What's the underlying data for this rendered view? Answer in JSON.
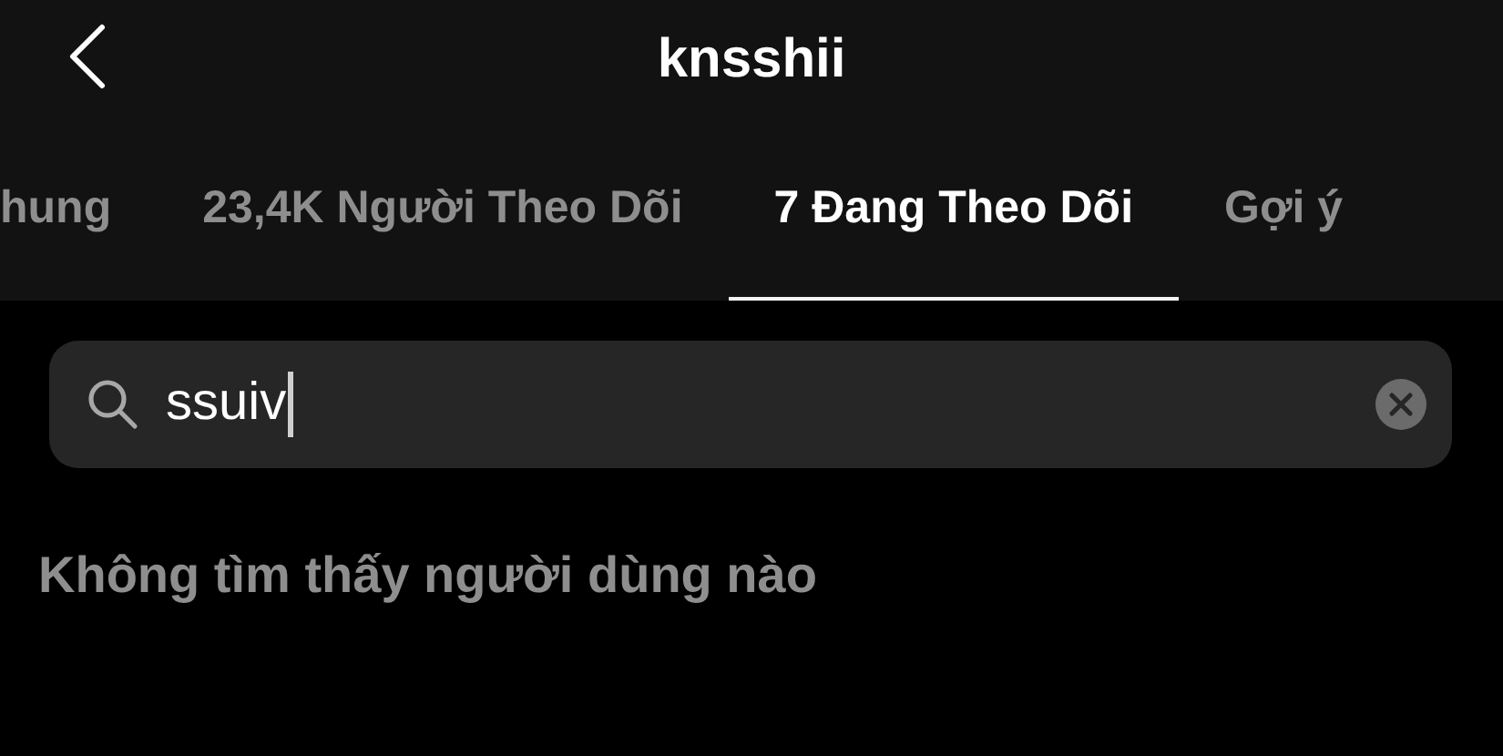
{
  "header": {
    "title": "knsshii"
  },
  "tabs": [
    {
      "label": "hung",
      "selected": false
    },
    {
      "label": "23,4K Người Theo Dõi",
      "selected": false
    },
    {
      "label": "7 Đang Theo Dõi",
      "selected": true
    },
    {
      "label": "Gợi ý",
      "selected": false
    }
  ],
  "search": {
    "value": "ssuiv"
  },
  "empty_message": "Không tìm thấy người dùng nào"
}
